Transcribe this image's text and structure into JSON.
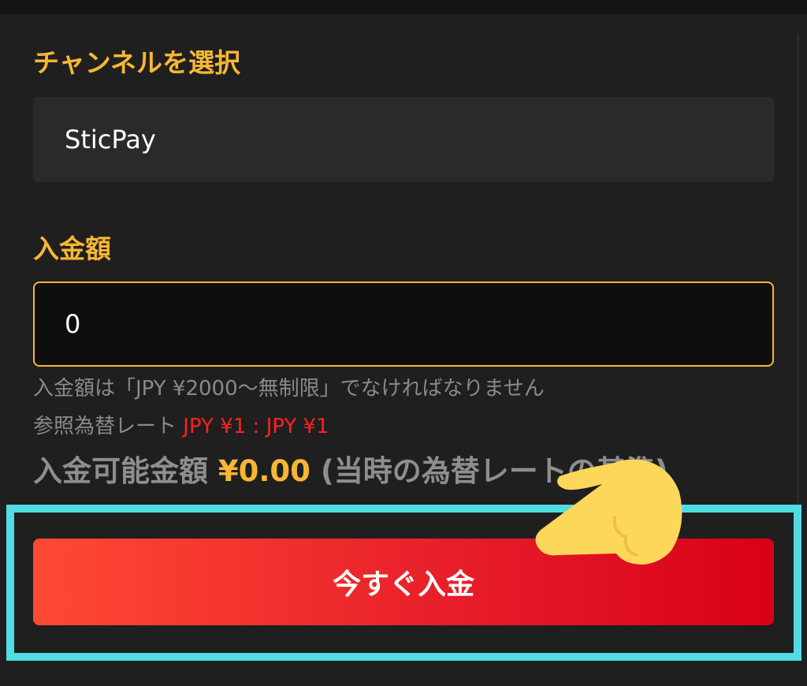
{
  "channel": {
    "label": "チャンネルを選択",
    "selected": "SticPay"
  },
  "amount": {
    "label": "入金額",
    "value": "0"
  },
  "hints": {
    "range": "入金額は「JPY ¥2000〜無制限」でなければなりません",
    "rate_label": "参照為替レート",
    "rate_value": "JPY ¥1 : JPY ¥1"
  },
  "available": {
    "prefix": "入金可能金額",
    "amount": "¥0.00",
    "suffix": "(当時の為替レートの基準)"
  },
  "button": {
    "label": "今すぐ入金"
  },
  "colors": {
    "accent": "#f7b733",
    "rate": "#ff2121",
    "button_start": "#ff4a33",
    "button_end": "#d80017",
    "highlight": "#51dbe3",
    "pointer": "#fdd75a"
  }
}
